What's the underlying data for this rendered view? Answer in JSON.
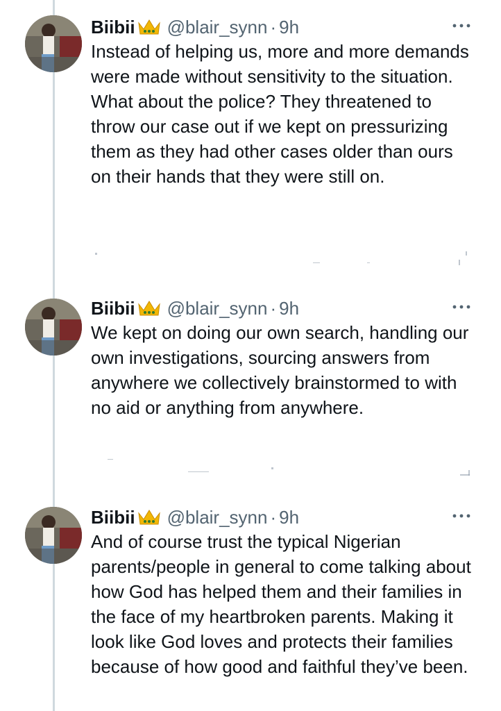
{
  "thread": {
    "tweets": [
      {
        "display_name": "Biibii",
        "handle": "@blair_synn",
        "separator": "·",
        "time": "9h",
        "text": "Instead of helping us, more and more demands were made without sensitivity to the situation.\nWhat about the police? They threatened to throw our case out if we kept on pressurizing them as they had other cases older than ours on their hands that they were still on."
      },
      {
        "display_name": "Biibii",
        "handle": "@blair_synn",
        "separator": "·",
        "time": "9h",
        "text": "We kept on doing our own search, handling our own investigations, sourcing answers from anywhere we collectively brainstormed to with no aid or anything from anywhere."
      },
      {
        "display_name": "Biibii",
        "handle": "@blair_synn",
        "separator": "·",
        "time": "9h",
        "text": "And of course trust the typical Nigerian parents/people in general to come talking about how God has helped them and their families in the face of my heartbroken parents. Making it look like God loves and protects their families because of how good and faithful they’ve been."
      }
    ]
  },
  "icons": {
    "crown": "crown-icon",
    "more": "more-icon"
  },
  "colors": {
    "text": "#0f1419",
    "secondary": "#536471",
    "thread_line": "#cfd9de",
    "crown_gold": "#f2b705"
  }
}
